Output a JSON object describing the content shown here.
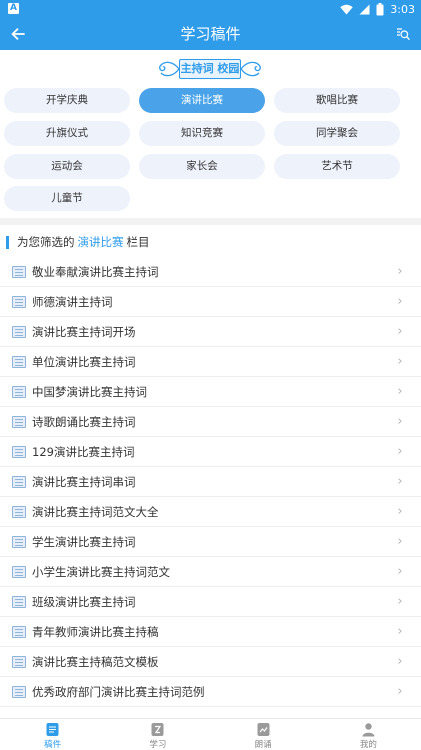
{
  "status_bar": {
    "left_badge": "A",
    "time": "3:03"
  },
  "app_bar": {
    "title": "学习稿件"
  },
  "banner": {
    "text": "主持词 校园"
  },
  "categories": [
    {
      "label": "开学庆典",
      "active": false
    },
    {
      "label": "演讲比赛",
      "active": true
    },
    {
      "label": "歌唱比赛",
      "active": false
    },
    {
      "label": "升旗仪式",
      "active": false
    },
    {
      "label": "知识竞赛",
      "active": false
    },
    {
      "label": "同学聚会",
      "active": false
    },
    {
      "label": "运动会",
      "active": false
    },
    {
      "label": "家长会",
      "active": false
    },
    {
      "label": "艺术节",
      "active": false
    },
    {
      "label": "儿童节",
      "active": false
    }
  ],
  "filter": {
    "prefix": "为您筛选的",
    "highlight": "演讲比赛",
    "suffix": "栏目"
  },
  "articles": [
    "敬业奉献演讲比赛主持词",
    "师德演讲主持词",
    "演讲比赛主持词开场",
    "单位演讲比赛主持词",
    "中国梦演讲比赛主持词",
    "诗歌朗诵比赛主持词",
    "129演讲比赛主持词",
    "演讲比赛主持词串词",
    "演讲比赛主持词范文大全",
    "学生演讲比赛主持词",
    "小学生演讲比赛主持词范文",
    "班级演讲比赛主持词",
    "青年教师演讲比赛主持稿",
    "演讲比赛主持稿范文模板",
    "优秀政府部门演讲比赛主持词范例"
  ],
  "tabs": [
    {
      "label": "稿件",
      "icon": "document-icon",
      "active": true
    },
    {
      "label": "学习",
      "icon": "study-icon",
      "active": false
    },
    {
      "label": "朗诵",
      "icon": "recite-icon",
      "active": false
    },
    {
      "label": "我的",
      "icon": "person-icon",
      "active": false
    }
  ],
  "colors": {
    "primary": "#2f9cea",
    "chip_bg": "#eef2fb",
    "chip_active": "#4aa3e8"
  }
}
